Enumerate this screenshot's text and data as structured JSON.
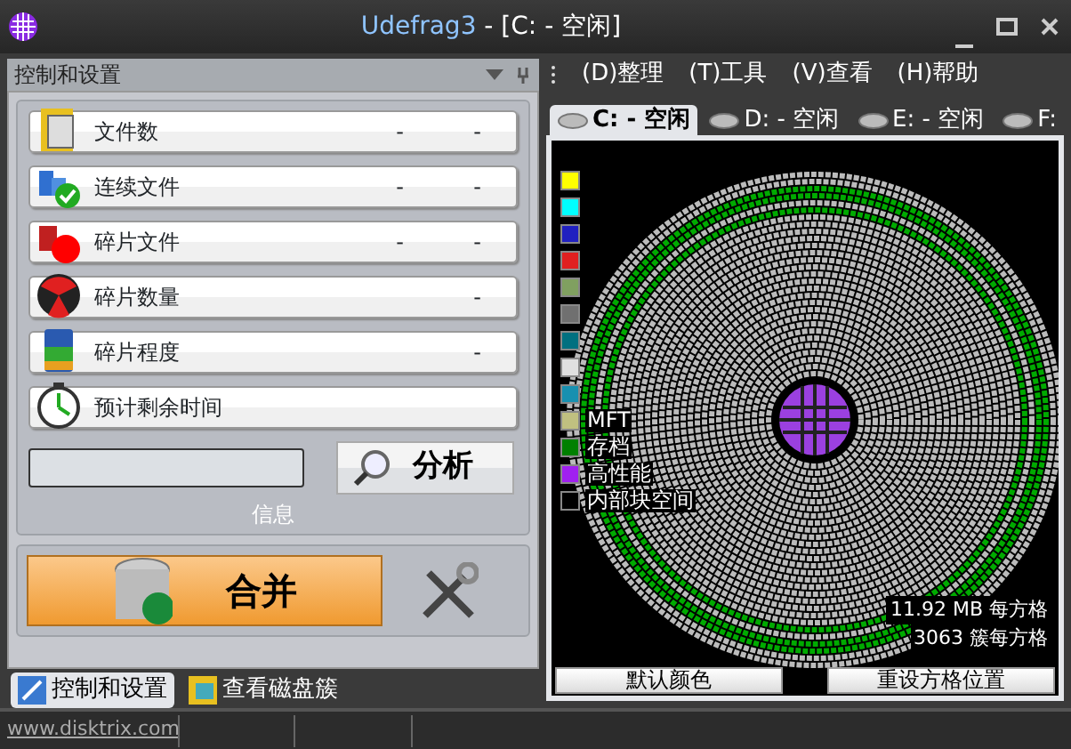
{
  "window": {
    "title_app": "Udefrag3",
    "title_rest": " - [C: - 空闲]"
  },
  "left_panel": {
    "title": "控制和设置",
    "stats": [
      {
        "label": "文件数",
        "values": [
          "-",
          "-"
        ]
      },
      {
        "label": "连续文件",
        "values": [
          "-",
          "-"
        ]
      },
      {
        "label": "碎片文件",
        "values": [
          "-",
          "-"
        ]
      },
      {
        "label": "碎片数量",
        "values": [
          "-"
        ]
      },
      {
        "label": "碎片程度",
        "values": [
          "-"
        ]
      },
      {
        "label": "预计剩余时间"
      }
    ],
    "analyze_button": "分析",
    "info_label": "信息",
    "merge_button": "合并",
    "bottom_tabs": [
      {
        "label": "控制和设置",
        "selected": true
      },
      {
        "label": "查看磁盘簇",
        "selected": false
      }
    ]
  },
  "menu": [
    "(D)整理",
    "(T)工具",
    "(V)查看",
    "(H)帮助"
  ],
  "drive_tabs": [
    {
      "label": "C: - 空闲",
      "selected": true
    },
    {
      "label": "D: - 空闲",
      "selected": false
    },
    {
      "label": "E: - 空闲",
      "selected": false
    },
    {
      "label": "F:",
      "selected": false
    }
  ],
  "legend": [
    {
      "color": "#ffff00"
    },
    {
      "color": "#00ffff"
    },
    {
      "color": "#2020c0"
    },
    {
      "color": "#e02020"
    },
    {
      "color": "#80a060"
    },
    {
      "color": "#707070"
    },
    {
      "color": "#007080"
    },
    {
      "color": "#e0e0e0"
    },
    {
      "color": "#1890b0"
    },
    {
      "label": "MFT",
      "color": "#c0c080"
    },
    {
      "label": "存档",
      "color": "#008000"
    },
    {
      "label": "高性能",
      "color": "#a020f0"
    },
    {
      "label": "内部块空间",
      "color": "#000000"
    }
  ],
  "disk_info": [
    "11.92 MB 每方格",
    "3063 簇每方格"
  ],
  "disk_buttons": [
    "默认颜色",
    "重设方格位置"
  ],
  "status_bar": {
    "link": "www.disktrix.com"
  }
}
